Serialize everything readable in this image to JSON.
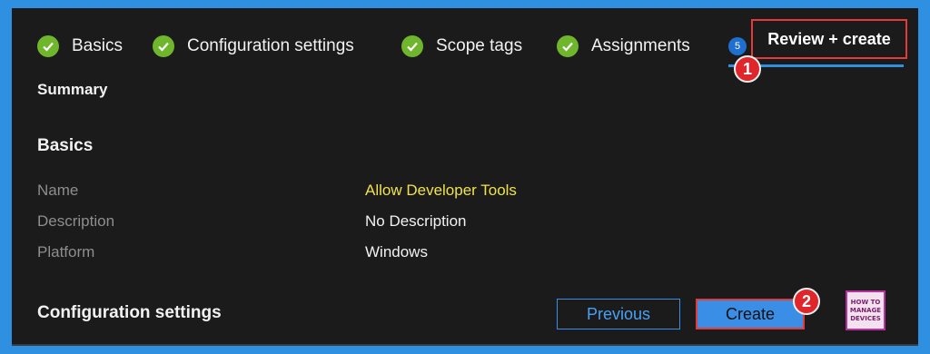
{
  "steps": [
    {
      "label": "Basics",
      "status": "complete"
    },
    {
      "label": "Configuration settings",
      "status": "complete"
    },
    {
      "label": "Scope tags",
      "status": "complete"
    },
    {
      "label": "Assignments",
      "status": "complete"
    },
    {
      "label": "Review + create",
      "number": "5",
      "status": "active"
    }
  ],
  "callouts": {
    "first": "1",
    "second": "2"
  },
  "summary_heading": "Summary",
  "basics": {
    "heading": "Basics",
    "rows": [
      {
        "key": "Name",
        "value": "Allow Developer Tools"
      },
      {
        "key": "Description",
        "value": "No Description"
      },
      {
        "key": "Platform",
        "value": "Windows"
      }
    ]
  },
  "config_heading": "Configuration settings",
  "buttons": {
    "previous": "Previous",
    "create": "Create"
  },
  "logo": {
    "line1": "HOW TO",
    "line2": "MANAGE",
    "line3": "DEVICES"
  },
  "colors": {
    "accent": "#3a8ee6",
    "check": "#6fb62c",
    "highlight": "#f0e24a",
    "callout": "#e0262b"
  }
}
